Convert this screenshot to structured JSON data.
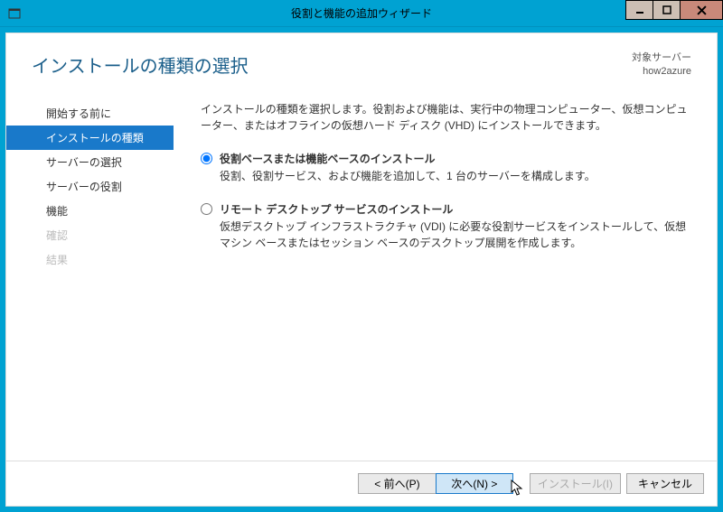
{
  "window": {
    "title": "役割と機能の追加ウィザード"
  },
  "header": {
    "page_title": "インストールの種類の選択",
    "target_label": "対象サーバー",
    "target_value": "how2azure"
  },
  "sidebar": {
    "items": [
      {
        "label": "開始する前に",
        "state": "normal"
      },
      {
        "label": "インストールの種類",
        "state": "active"
      },
      {
        "label": "サーバーの選択",
        "state": "normal"
      },
      {
        "label": "サーバーの役割",
        "state": "normal"
      },
      {
        "label": "機能",
        "state": "normal"
      },
      {
        "label": "確認",
        "state": "disabled"
      },
      {
        "label": "結果",
        "state": "disabled"
      }
    ]
  },
  "main": {
    "intro": "インストールの種類を選択します。役割および機能は、実行中の物理コンピューター、仮想コンピューター、またはオフラインの仮想ハード ディスク (VHD) にインストールできます。",
    "options": [
      {
        "title": "役割ベースまたは機能ベースのインストール",
        "desc": "役割、役割サービス、および機能を追加して、1 台のサーバーを構成します。",
        "selected": true
      },
      {
        "title": "リモート デスクトップ サービスのインストール",
        "desc": "仮想デスクトップ インフラストラクチャ (VDI) に必要な役割サービスをインストールして、仮想マシン ベースまたはセッション ベースのデスクトップ展開を作成します。",
        "selected": false
      }
    ]
  },
  "footer": {
    "prev": "< 前へ(P)",
    "next": "次へ(N) >",
    "install": "インストール(I)",
    "cancel": "キャンセル"
  }
}
